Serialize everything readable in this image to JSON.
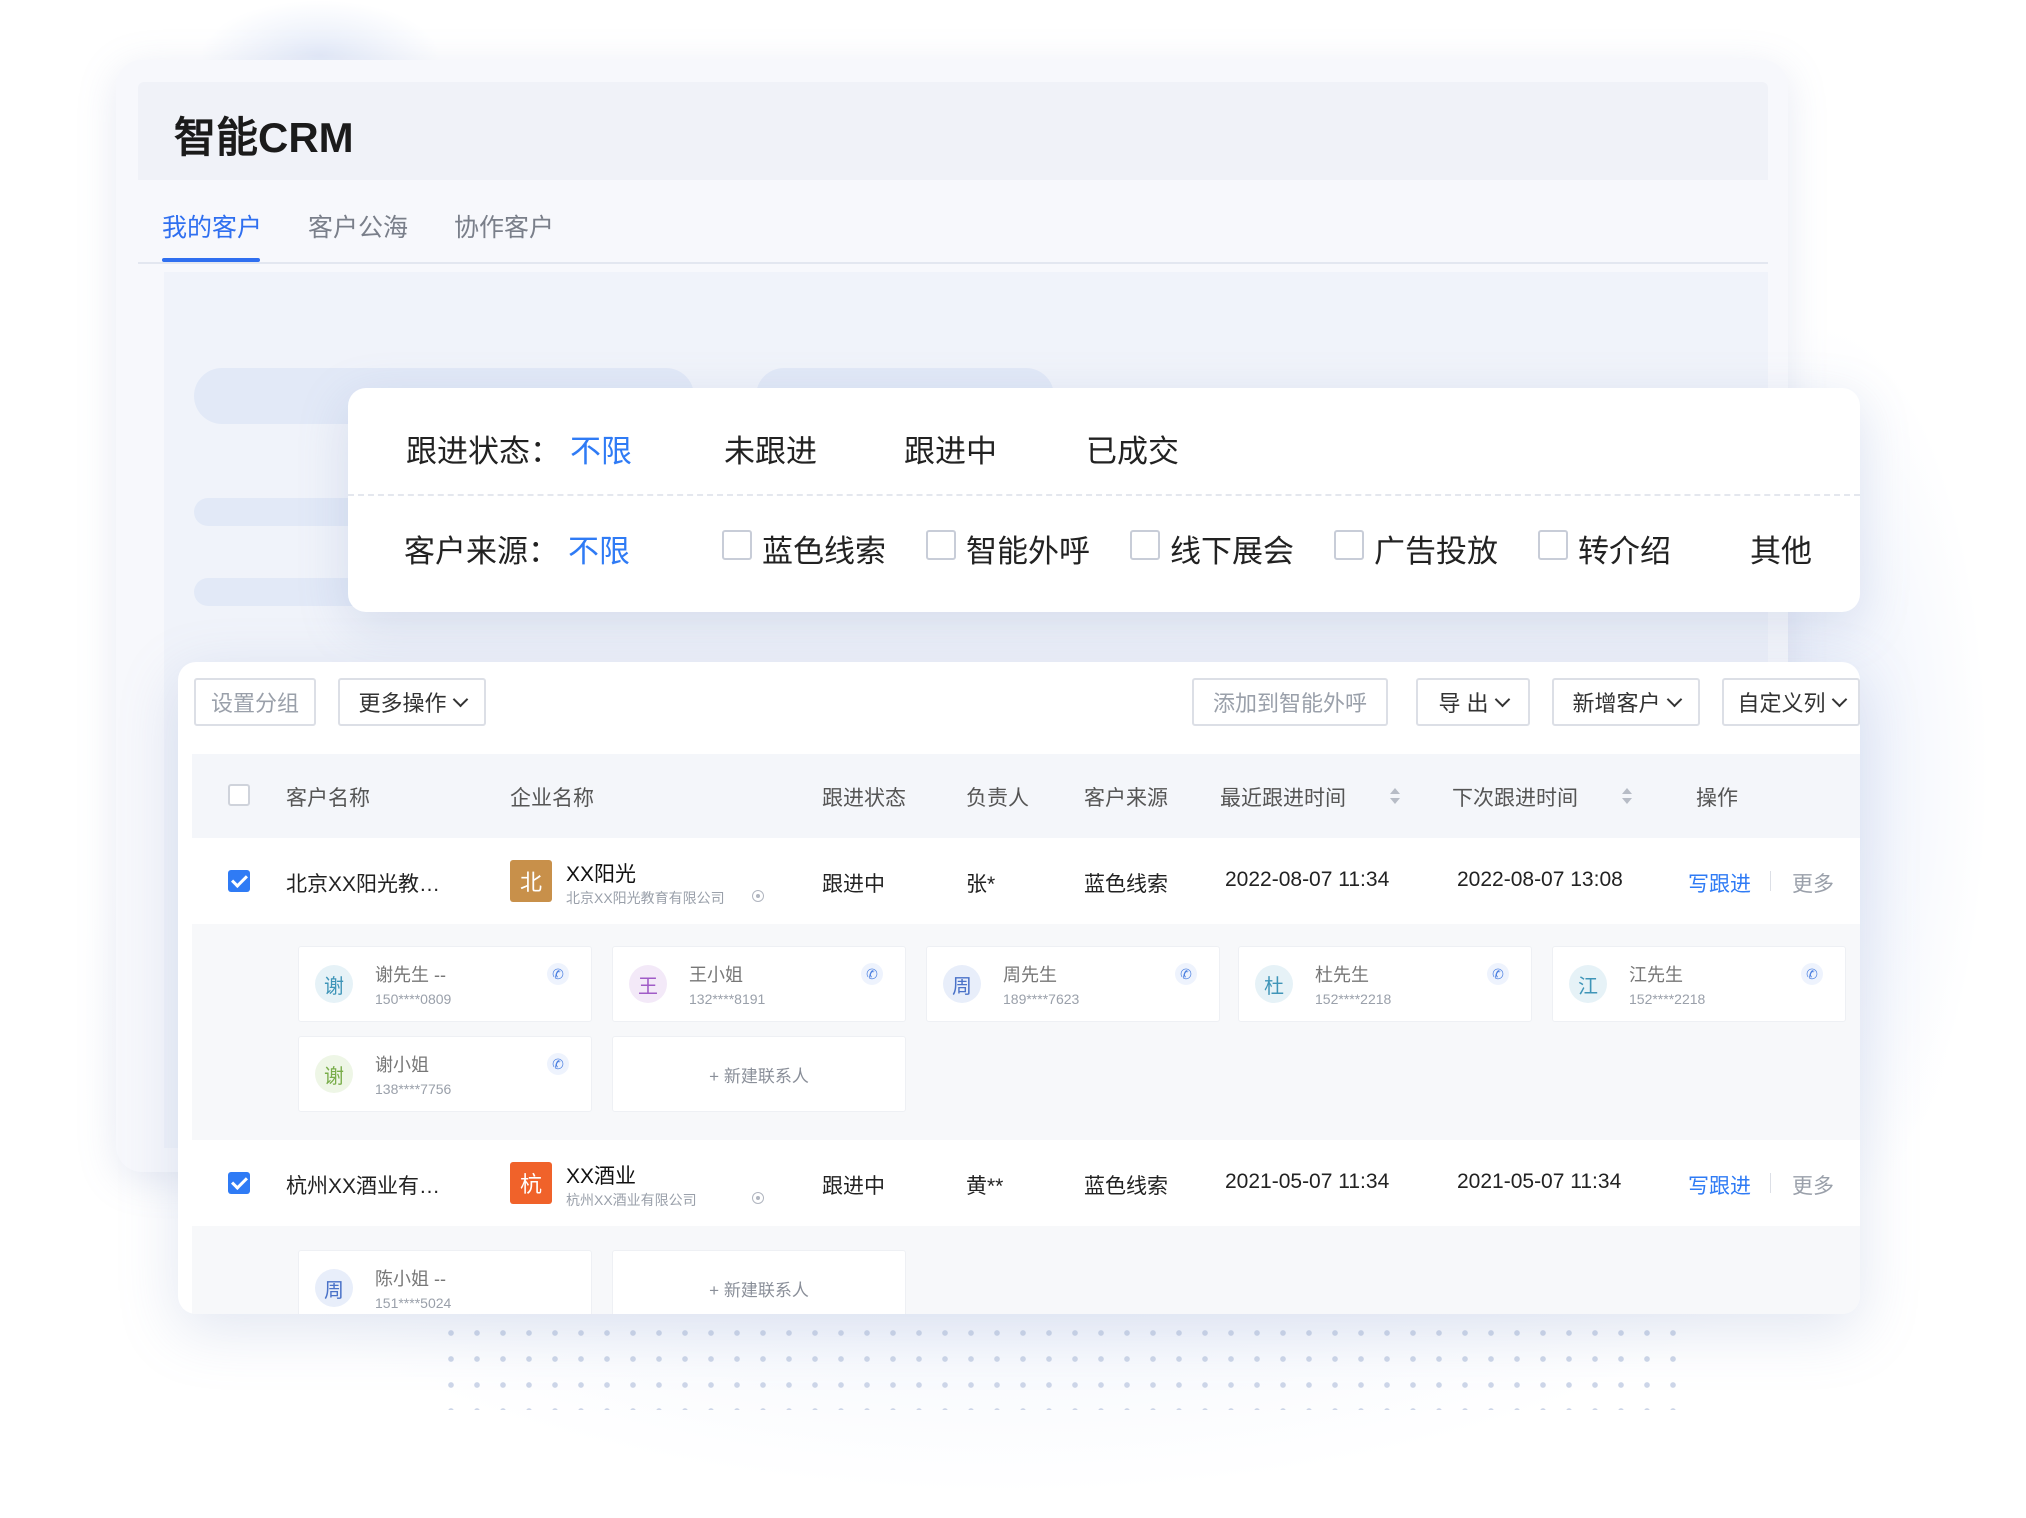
{
  "app": {
    "title": "智能CRM"
  },
  "tabs": [
    {
      "label": "我的客户",
      "active": true
    },
    {
      "label": "客户公海",
      "active": false
    },
    {
      "label": "协作客户",
      "active": false
    }
  ],
  "filters": {
    "status": {
      "label": "跟进状态：",
      "options": [
        "不限",
        "未跟进",
        "跟进中",
        "已成交"
      ],
      "selected": "不限"
    },
    "source": {
      "label": "客户来源：",
      "all": "不限",
      "options": [
        "蓝色线索",
        "智能外呼",
        "线下展会",
        "广告投放",
        "转介绍"
      ],
      "other": "其他"
    }
  },
  "toolbar": {
    "set_group": "设置分组",
    "more_actions": "更多操作",
    "add_to_call": "添加到智能外呼",
    "export": "导 出",
    "new_customer": "新增客户",
    "custom_columns": "自定义列"
  },
  "table": {
    "columns": [
      "客户名称",
      "企业名称",
      "跟进状态",
      "负责人",
      "客户来源",
      "最近跟进时间",
      "下次跟进时间",
      "操作"
    ],
    "rows": [
      {
        "customer": "北京XX阳光教…",
        "logo_char": "北",
        "logo_color": "#c8904a",
        "company": "XX阳光",
        "company_full": "北京XX阳光教育有限公司",
        "status": "跟进中",
        "owner": "张*",
        "source": "蓝色线索",
        "last_follow": "2022-08-07 11:34",
        "next_follow": "2022-08-07 13:08",
        "action_follow": "写跟进",
        "action_more": "更多",
        "contacts": [
          {
            "avatar": "谢",
            "name": "谢先生 --",
            "phone": "150****0809",
            "avatar_bg": "#e6f2f7",
            "avatar_fg": "#3f95b8"
          },
          {
            "avatar": "王",
            "name": "王小姐",
            "phone": "132****8191",
            "avatar_bg": "#f3e9f8",
            "avatar_fg": "#a05cc7"
          },
          {
            "avatar": "周",
            "name": "周先生",
            "phone": "189****7623",
            "avatar_bg": "#e8eefa",
            "avatar_fg": "#4a72c8"
          },
          {
            "avatar": "杜",
            "name": "杜先生",
            "phone": "152****2218",
            "avatar_bg": "#e6f2f7",
            "avatar_fg": "#3f95b8"
          },
          {
            "avatar": "江",
            "name": "江先生",
            "phone": "152****2218",
            "avatar_bg": "#e6f2f7",
            "avatar_fg": "#3f95b8"
          },
          {
            "avatar": "谢",
            "name": "谢小姐",
            "phone": "138****7756",
            "avatar_bg": "#eef6e6",
            "avatar_fg": "#79ad4a"
          }
        ],
        "new_contact": "+ 新建联系人"
      },
      {
        "customer": "杭州XX酒业有…",
        "logo_char": "杭",
        "logo_color": "#f0622a",
        "company": "XX酒业",
        "company_full": "杭州XX酒业有限公司",
        "status": "跟进中",
        "owner": "黄**",
        "source": "蓝色线索",
        "last_follow": "2021-05-07 11:34",
        "next_follow": "2021-05-07 11:34",
        "action_follow": "写跟进",
        "action_more": "更多",
        "contacts": [
          {
            "avatar": "周",
            "name": "陈小姐 --",
            "phone": "151****5024",
            "avatar_bg": "#e8eefa",
            "avatar_fg": "#4a72c8"
          }
        ],
        "new_contact": "+ 新建联系人"
      }
    ]
  },
  "colors": {
    "accent": "#2f7bf5",
    "checked": "#2f7bf5"
  }
}
